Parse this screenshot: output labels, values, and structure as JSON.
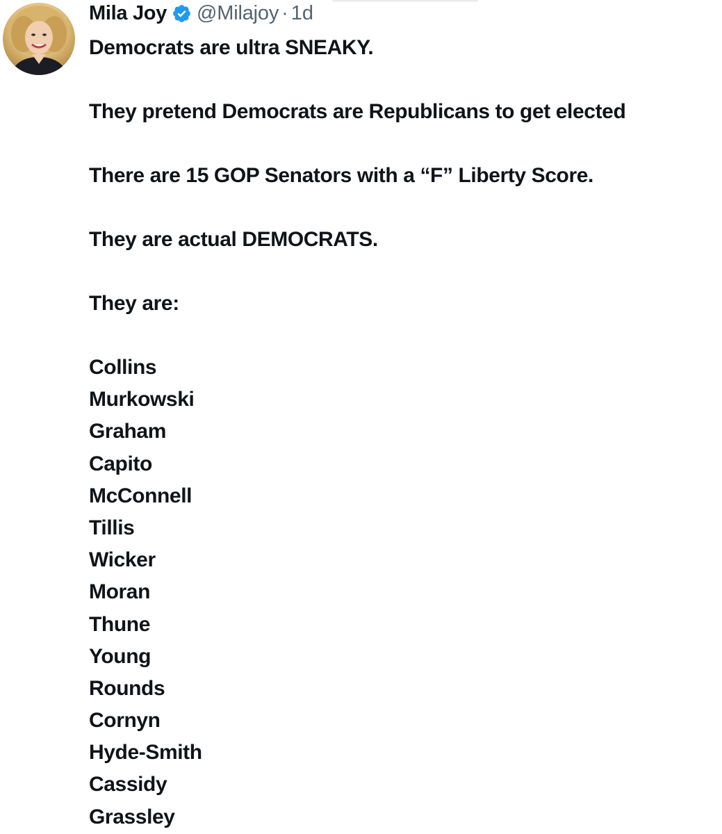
{
  "tweet": {
    "author": {
      "display_name": "Mila Joy",
      "handle": "@Milajoy",
      "verified": true,
      "avatar": "profile-photo"
    },
    "separator": "·",
    "time": "1d",
    "paragraphs": [
      "Democrats are ultra SNEAKY.",
      "They pretend Democrats are Republicans to get elected",
      "There are 15 GOP Senators with a “F” Liberty Score.",
      "They are actual DEMOCRATS.",
      "They are:"
    ],
    "names": [
      "Collins",
      "Murkowski",
      "Graham",
      "Capito",
      "McConnell",
      "Tillis",
      "Wicker",
      "Moran",
      "Thune",
      "Young",
      "Rounds",
      "Cornyn",
      "Hyde-Smith",
      "Cassidy",
      "Grassley"
    ]
  },
  "colors": {
    "text_primary": "#0f1419",
    "text_secondary": "#536471",
    "verified_badge": "#1d9bf0"
  },
  "icons": {
    "verified": "verified-badge-icon"
  }
}
